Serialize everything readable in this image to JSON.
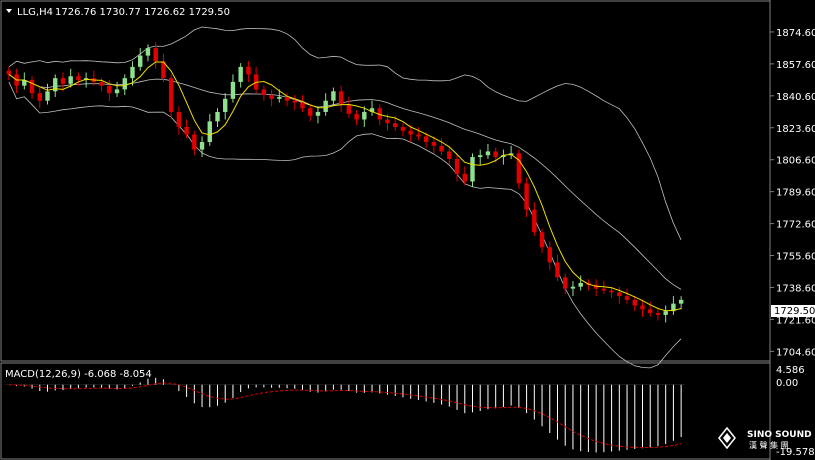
{
  "header": {
    "symbol_text": "LLG,H4",
    "ohlc_text": "1726.76 1730.77 1726.62 1729.50"
  },
  "macd": {
    "label_text": "MACD(12,26,9) -6.068 -8.054",
    "scale_top": "4.586",
    "scale_zero": "0.00",
    "scale_bottom": "-19.578"
  },
  "current_price": "1729.50",
  "watermark": {
    "brand": "SINO SOUND",
    "sub": "漢 聲 集 團"
  },
  "colors": {
    "background": "#000000",
    "bull": "#8fe08f",
    "bear": "#e00000",
    "bands": "#c0c0c0",
    "ma": "#f0e000",
    "signal": "#e00000",
    "hist": "#ffffff"
  },
  "chart_data": [
    {
      "type": "line",
      "title": "",
      "series": [
        {
          "name": "",
          "values": [
            1852,
            1846,
            1849,
            1842,
            1838,
            1843,
            1850,
            1847,
            1851,
            1849,
            1850,
            1848,
            1846,
            1842,
            1844,
            1850,
            1856,
            1862,
            1866,
            1859,
            1850,
            1832,
            1824,
            1820,
            1812,
            1816,
            1827,
            1832,
            1839,
            1848,
            1856,
            1852,
            1844,
            1841,
            1839,
            1840,
            1838,
            1837,
            1834,
            1830,
            1832,
            1838,
            1843,
            1836,
            1831,
            1828,
            1832,
            1834,
            1828,
            1826,
            1824,
            1822,
            1820,
            1819,
            1816,
            1814,
            1811,
            1807,
            1799,
            1795,
            1808,
            1809,
            1811,
            1808,
            1809,
            1810,
            1794,
            1780,
            1768,
            1760,
            1752,
            1744,
            1738,
            1739,
            1741,
            1740,
            1738,
            1737,
            1736,
            1734,
            1732,
            1729,
            1727,
            1725,
            1724,
            1726,
            1730,
            1732
          ]
        }
      ],
      "ylim": [
        1700,
        1890
      ],
      "y_ticks": [
        "1874.60",
        "1857.60",
        "1840.60",
        "1823.60",
        "1806.60",
        "1789.60",
        "1772.60",
        "1755.60",
        "1738.60",
        "1721.60",
        "1704.60"
      ]
    },
    {
      "type": "bar",
      "title": "MACD(12,26,9)",
      "macd_value": -6.068,
      "signal_value": -8.054,
      "ylim": [
        -19.578,
        4.586
      ]
    }
  ]
}
